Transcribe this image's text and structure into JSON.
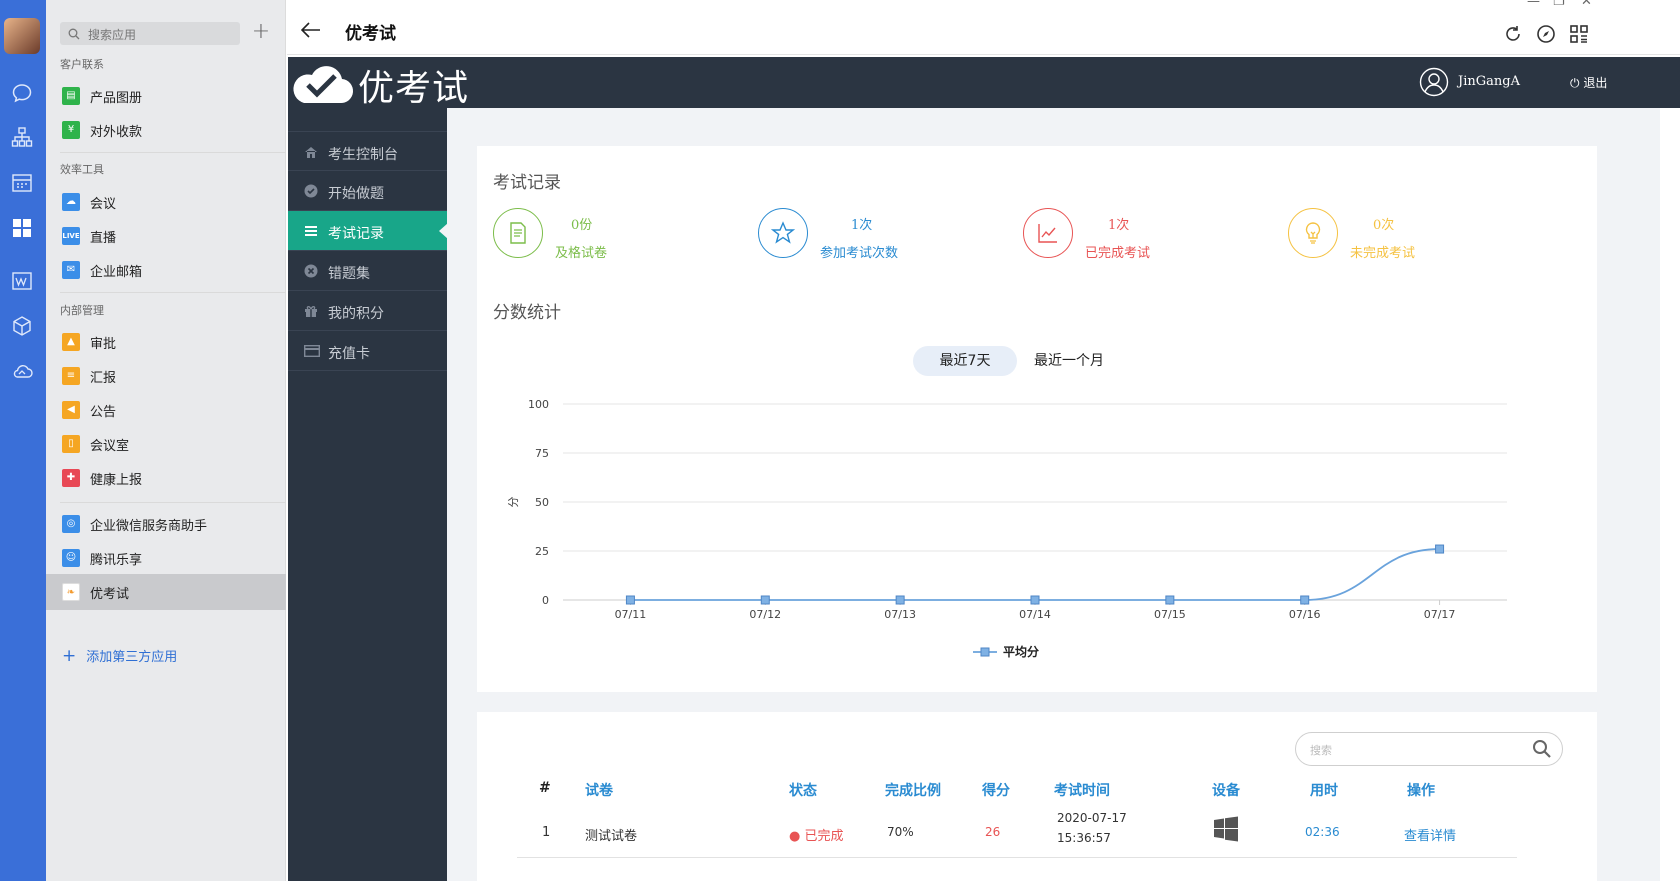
{
  "sidebar_apps": {
    "search_placeholder": "搜索应用",
    "sections": [
      {
        "title": "客户联系",
        "items": [
          {
            "label": "产品图册"
          },
          {
            "label": "对外收款"
          }
        ]
      },
      {
        "title": "效率工具",
        "items": [
          {
            "label": "会议"
          },
          {
            "label": "直播",
            "badge": "LIVE"
          },
          {
            "label": "企业邮箱"
          }
        ]
      },
      {
        "title": "内部管理",
        "items": [
          {
            "label": "审批"
          },
          {
            "label": "汇报"
          },
          {
            "label": "公告"
          },
          {
            "label": "会议室"
          },
          {
            "label": "健康上报"
          }
        ]
      }
    ],
    "third_party": [
      {
        "label": "企业微信服务商助手"
      },
      {
        "label": "腾讯乐享"
      },
      {
        "label": "优考试"
      }
    ],
    "add_label": "添加第三方应用"
  },
  "header": {
    "title": "优考试"
  },
  "app": {
    "logo_text": "优考试",
    "username": "JinGangA",
    "logout_label": "退出"
  },
  "menu": [
    {
      "label": "考生控制台",
      "icon": "home-icon"
    },
    {
      "label": "开始做题",
      "icon": "check-circle-icon"
    },
    {
      "label": "考试记录",
      "icon": "list-icon",
      "active": true
    },
    {
      "label": "错题集",
      "icon": "x-circle-icon"
    },
    {
      "label": "我的积分",
      "icon": "gift-icon"
    },
    {
      "label": "充值卡",
      "icon": "card-icon"
    }
  ],
  "exam_records": {
    "title": "考试记录",
    "stats": [
      {
        "value": "0份",
        "caption": "及格试卷",
        "color": "#7cbd4a",
        "icon": "document-icon"
      },
      {
        "value": "1次",
        "caption": "参加考试次数",
        "color": "#2a8bd1",
        "icon": "star-icon"
      },
      {
        "value": "1次",
        "caption": "已完成考试",
        "color": "#e85454",
        "icon": "line-chart-icon"
      },
      {
        "value": "0次",
        "caption": "未完成考试",
        "color": "#f5c242",
        "icon": "bulb-icon"
      }
    ]
  },
  "score_stats": {
    "title": "分数统计",
    "tabs": [
      "最近7天",
      "最近一个月"
    ],
    "active_tab": 0
  },
  "chart_data": {
    "type": "line",
    "categories": [
      "07/11",
      "07/12",
      "07/13",
      "07/14",
      "07/15",
      "07/16",
      "07/17"
    ],
    "series": [
      {
        "name": "平均分",
        "values": [
          0,
          0,
          0,
          0,
          0,
          0,
          26
        ],
        "color": "#6aa3dc"
      }
    ],
    "ylabel": "分",
    "ylim": [
      0,
      100
    ],
    "yticks": [
      0,
      25,
      50,
      75,
      100
    ],
    "grid": true,
    "legend": "bottom-center"
  },
  "table": {
    "search_placeholder": "搜索",
    "columns": [
      "#",
      "试卷",
      "状态",
      "完成比例",
      "得分",
      "考试时间",
      "设备",
      "用时",
      "操作"
    ],
    "rows": [
      {
        "index": "1",
        "paper": "测试试卷",
        "status": "已完成",
        "ratio": "70%",
        "score": "26",
        "date": "2020-07-17",
        "time": "15:36:57",
        "device": "windows-icon",
        "duration": "02:36",
        "action": "查看详情"
      }
    ]
  }
}
